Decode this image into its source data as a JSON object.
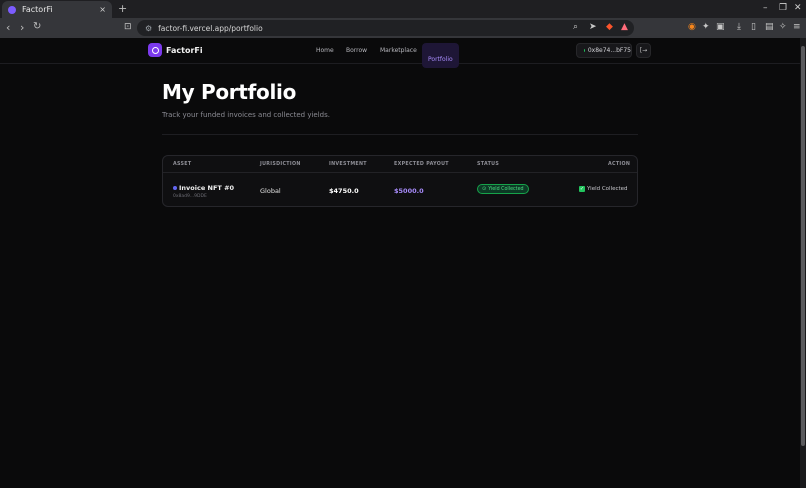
{
  "browser": {
    "tab_title": "FactorFi",
    "tab_close": "×",
    "new_tab": "+",
    "url": "factor-fi.vercel.app/portfolio",
    "window_minimize": "–",
    "window_restore": "❐",
    "window_close": "✕"
  },
  "app": {
    "brand": "FactorFi",
    "nav": {
      "home": "Home",
      "borrow": "Borrow",
      "marketplace": "Marketplace",
      "portfolio": "Portfolio"
    },
    "wallet_address": "0x8e74...bF75",
    "logout_icon": "[→"
  },
  "page": {
    "title": "My Portfolio",
    "subtitle": "Track your funded invoices and collected yields."
  },
  "table": {
    "headers": {
      "asset": "ASSET",
      "jurisdiction": "JURISDICTION",
      "investment": "INVESTMENT",
      "expected_payout": "EXPECTED PAYOUT",
      "status": "STATUS",
      "action": "ACTION"
    },
    "rows": [
      {
        "asset_name": "Invoice NFT #0",
        "asset_sub": "0x8ad9...9DDE",
        "jurisdiction": "Global",
        "investment": "$4750.0",
        "expected_payout": "$5000.0",
        "status": "Yield Collected",
        "action": "Yield Collected"
      }
    ]
  },
  "colors": {
    "accent": "#7c3aed",
    "payout": "#a78bfa",
    "status_green": "#4ade80"
  }
}
